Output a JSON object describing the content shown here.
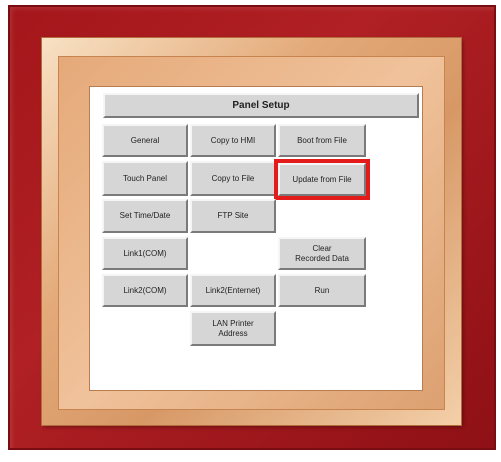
{
  "panel": {
    "title": "Panel Setup",
    "buttons": {
      "general": "General",
      "copy_to_hmi": "Copy to HMI",
      "boot_from_file": "Boot from File",
      "touch_panel": "Touch Panel",
      "copy_to_file": "Copy to File",
      "update_from_file": "Update from File",
      "set_time_date": "Set Time/Date",
      "ftp_site": "FTP Site",
      "link1_com": "Link1(COM)",
      "clear_recorded_data": "Clear\nRecorded Data",
      "link2_com": "Link2(COM)",
      "link2_ethernet": "Link2(Enternet)",
      "run": "Run",
      "lan_printer_address": "LAN Printer\nAddress"
    }
  },
  "colors": {
    "frame_red": "#a4161b",
    "frame_gold": "#e3a978",
    "button_face": "#d6d6d6",
    "highlight": "#e41b1b"
  }
}
